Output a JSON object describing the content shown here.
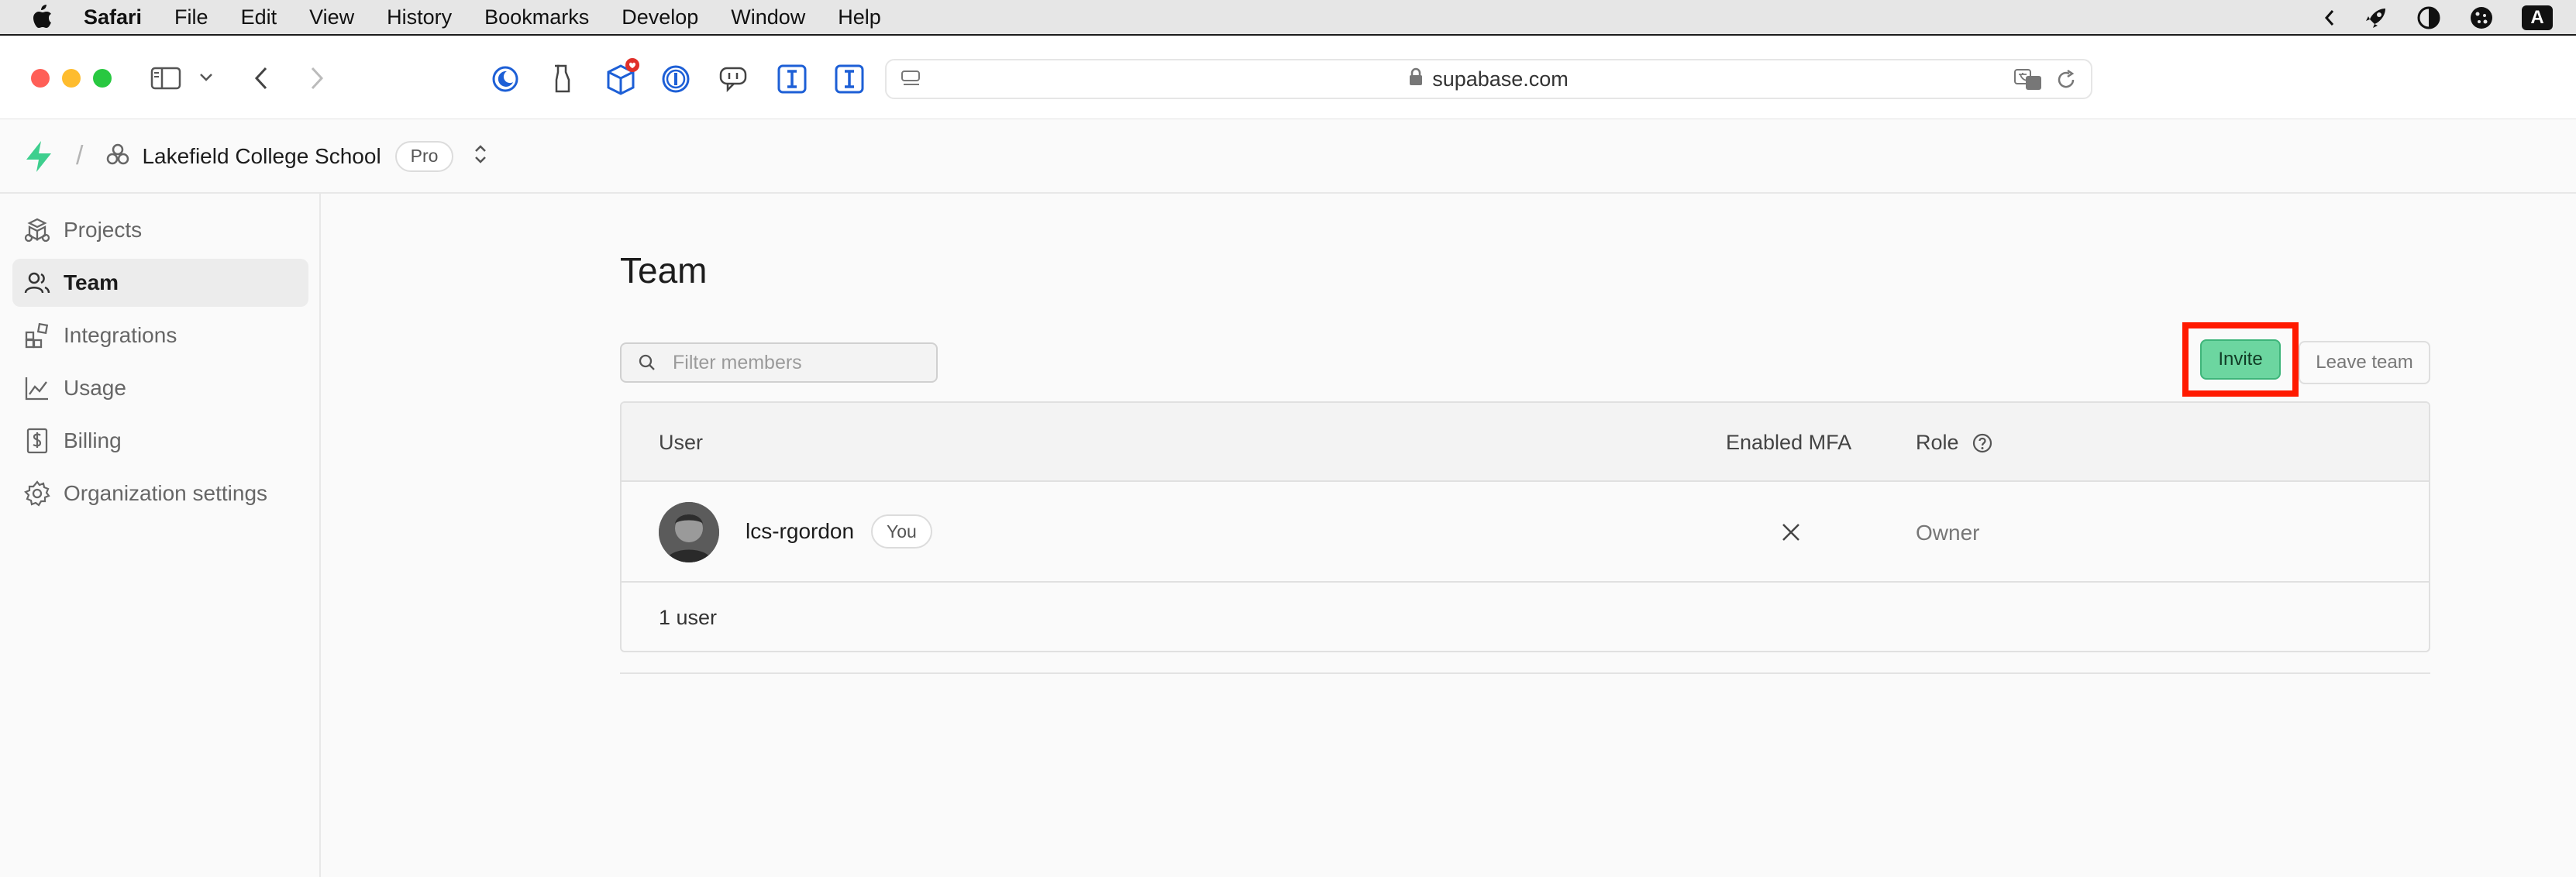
{
  "menubar": {
    "app_name": "Safari",
    "items": [
      "File",
      "Edit",
      "View",
      "History",
      "Bookmarks",
      "Develop",
      "Window",
      "Help"
    ],
    "input_badge": "A"
  },
  "browser": {
    "url": "supabase.com"
  },
  "header": {
    "org_name": "Lakefield College School",
    "plan_badge": "Pro"
  },
  "sidebar": {
    "items": [
      {
        "label": "Projects",
        "icon": "projects-icon"
      },
      {
        "label": "Team",
        "icon": "team-icon",
        "active": true
      },
      {
        "label": "Integrations",
        "icon": "integrations-icon"
      },
      {
        "label": "Usage",
        "icon": "usage-icon"
      },
      {
        "label": "Billing",
        "icon": "billing-icon"
      },
      {
        "label": "Organization settings",
        "icon": "gear-icon"
      }
    ]
  },
  "main": {
    "title": "Team",
    "filter_placeholder": "Filter members",
    "invite_label": "Invite",
    "leave_label": "Leave team",
    "table": {
      "columns": [
        "User",
        "Enabled MFA",
        "Role"
      ],
      "rows": [
        {
          "username": "lcs-rgordon",
          "badge": "You",
          "mfa_enabled": false,
          "role": "Owner"
        }
      ],
      "footer": "1 user"
    }
  },
  "colors": {
    "brand_green": "#3ecf8e",
    "invite_bg": "#6cd6a0",
    "highlight_red": "#ff1a00"
  }
}
